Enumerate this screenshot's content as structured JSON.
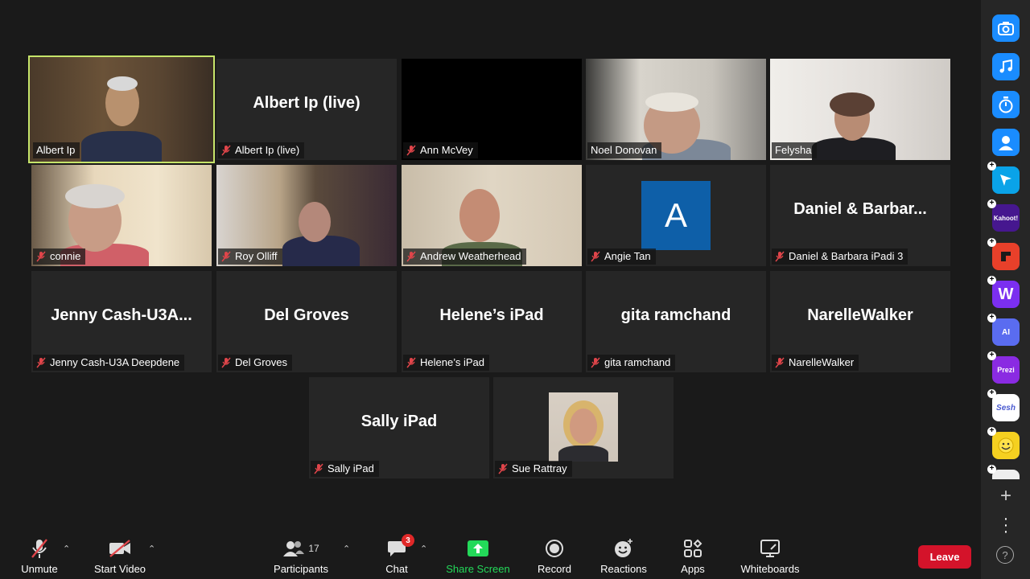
{
  "participants": [
    {
      "label": "Albert Ip",
      "muted": false,
      "kind": "video"
    },
    {
      "label": "Albert Ip (live)",
      "bigname": "Albert Ip (live)",
      "muted": true,
      "kind": "name"
    },
    {
      "label": "Ann McVey",
      "muted": true,
      "kind": "black"
    },
    {
      "label": "Noel Donovan",
      "muted": false,
      "kind": "video"
    },
    {
      "label": "Felysha",
      "muted": false,
      "kind": "video"
    },
    {
      "label": "connie",
      "muted": true,
      "kind": "video"
    },
    {
      "label": "Roy Olliff",
      "muted": true,
      "kind": "video"
    },
    {
      "label": "Andrew Weatherhead",
      "muted": true,
      "kind": "video"
    },
    {
      "label": "Angie Tan",
      "avatar_letter": "A",
      "muted": true,
      "kind": "avatar"
    },
    {
      "label": "Daniel & Barbara iPadi 3",
      "bigname": "Daniel & Barbar...",
      "muted": true,
      "kind": "name"
    },
    {
      "label": "Jenny Cash-U3A Deepdene",
      "bigname": "Jenny Cash-U3A...",
      "muted": true,
      "kind": "name"
    },
    {
      "label": "Del Groves",
      "bigname": "Del Groves",
      "muted": true,
      "kind": "name"
    },
    {
      "label": "Helene’s iPad",
      "bigname": "Helene’s iPad",
      "muted": true,
      "kind": "name"
    },
    {
      "label": "gita ramchand",
      "bigname": "gita ramchand",
      "muted": true,
      "kind": "name"
    },
    {
      "label": "NarelleWalker",
      "bigname": "NarelleWalker",
      "muted": true,
      "kind": "name"
    },
    {
      "label": "Sally iPad",
      "bigname": "Sally iPad",
      "muted": true,
      "kind": "name"
    },
    {
      "label": "Sue Rattray",
      "muted": true,
      "kind": "photo"
    }
  ],
  "toolbar": {
    "unmute": "Unmute",
    "start_video": "Start Video",
    "participants": "Participants",
    "participants_count": "17",
    "chat": "Chat",
    "chat_badge": "3",
    "share_screen": "Share Screen",
    "record": "Record",
    "reactions": "Reactions",
    "apps": "Apps",
    "whiteboards": "Whiteboards",
    "leave": "Leave"
  },
  "rail": {
    "kahoot": "Kahoot!",
    "prezi": "Prezi",
    "sesh": "Sesh",
    "ai": "AI"
  },
  "colors": {
    "active_speaker_border": "#c6e46a",
    "share_green": "#23d959",
    "leave_red": "#d4132a",
    "avatar_blue": "#0e5fa8",
    "muted_red": "#e0454a"
  }
}
